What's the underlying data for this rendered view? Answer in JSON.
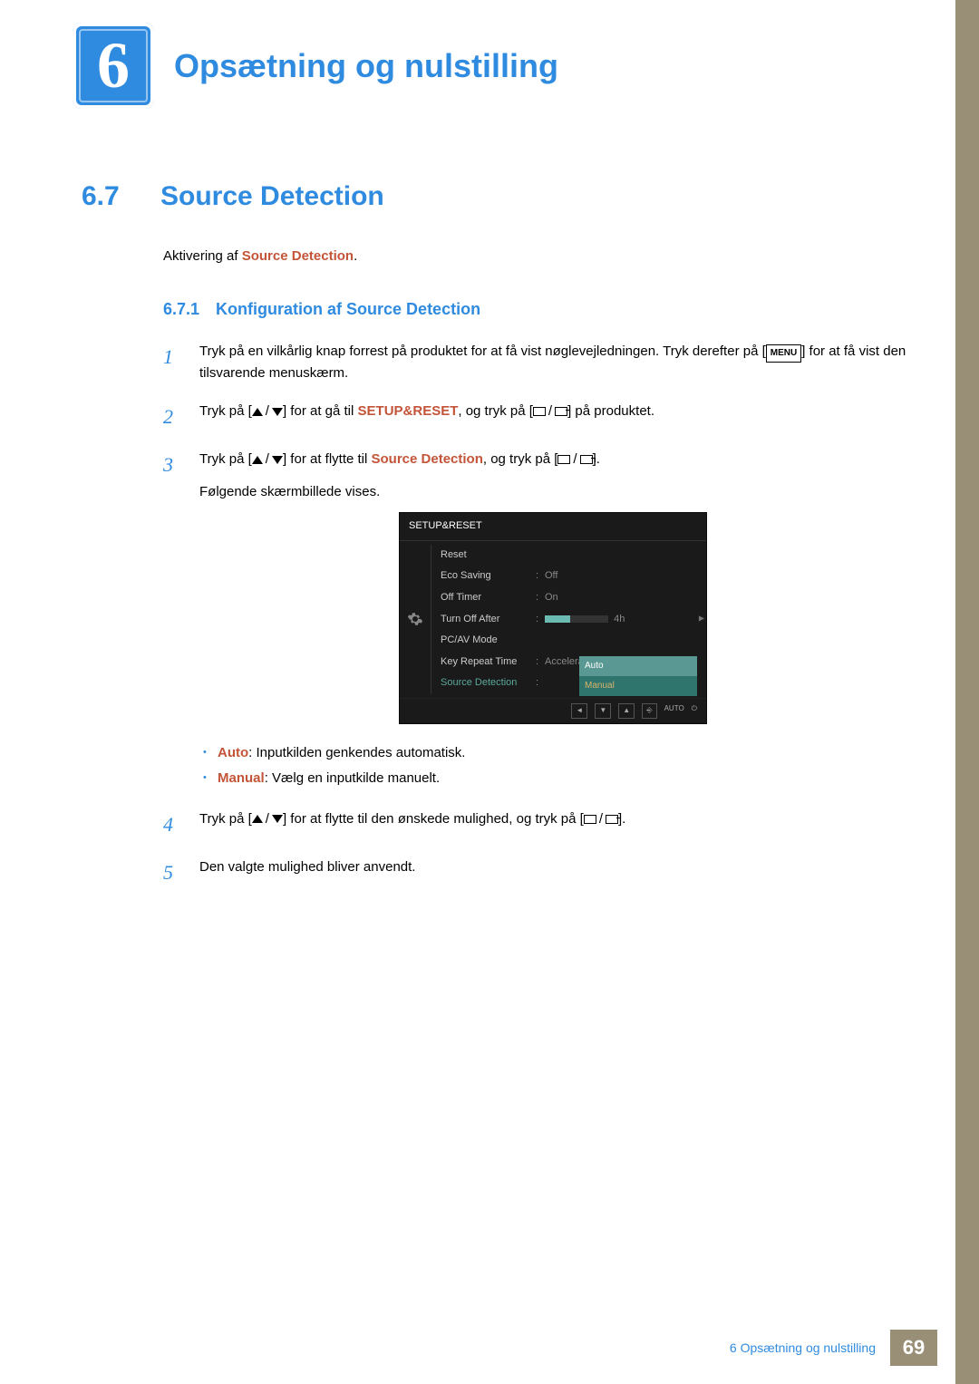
{
  "chapter": {
    "number": "6",
    "title": "Opsætning og nulstilling"
  },
  "section": {
    "number": "6.7",
    "title": "Source Detection"
  },
  "intro": {
    "prefix": "Aktivering af ",
    "keyword": "Source Detection",
    "suffix": "."
  },
  "subsection": {
    "number": "6.7.1",
    "title": "Konfiguration af Source Detection"
  },
  "steps": {
    "s1": {
      "n": "1",
      "a": "Tryk på en vilkårlig knap forrest på produktet for at få vist nøglevejledningen. Tryk derefter på [",
      "menu": "MENU",
      "b": "] for at få vist den tilsvarende menuskærm."
    },
    "s2": {
      "n": "2",
      "a": "Tryk på [",
      "b": "] for at gå til ",
      "kw": "SETUP&RESET",
      "c": ", og tryk på [",
      "d": "] på produktet."
    },
    "s3": {
      "n": "3",
      "a": "Tryk på [",
      "b": "] for at flytte til ",
      "kw": "Source Detection",
      "c": ", og tryk på [",
      "d": "].",
      "follow": "Følgende skærmbillede vises."
    },
    "s4": {
      "n": "4",
      "a": "Tryk på [",
      "b": "] for at flytte til den ønskede mulighed, og tryk på [",
      "c": "]."
    },
    "s5": {
      "n": "5",
      "a": "Den valgte mulighed bliver anvendt."
    }
  },
  "bullets": {
    "auto": {
      "kw": "Auto",
      "text": ": Inputkilden genkendes automatisk."
    },
    "manual": {
      "kw": "Manual",
      "text": ": Vælg en inputkilde manuelt."
    }
  },
  "osd": {
    "title": "SETUP&RESET",
    "reset": "Reset",
    "eco": "Eco Saving",
    "eco_v": "Off",
    "offtimer": "Off Timer",
    "offtimer_v": "On",
    "turnoff": "Turn Off After",
    "turnoff_v": "4h",
    "pcav": "PC/AV Mode",
    "keyrepeat": "Key Repeat Time",
    "keyrepeat_v": "Acceleration",
    "srcdet": "Source Detection",
    "dd_auto": "Auto",
    "dd_manual": "Manual",
    "btn_auto": "AUTO"
  },
  "footer": {
    "text": "6 Opsætning og nulstilling",
    "page": "69"
  }
}
